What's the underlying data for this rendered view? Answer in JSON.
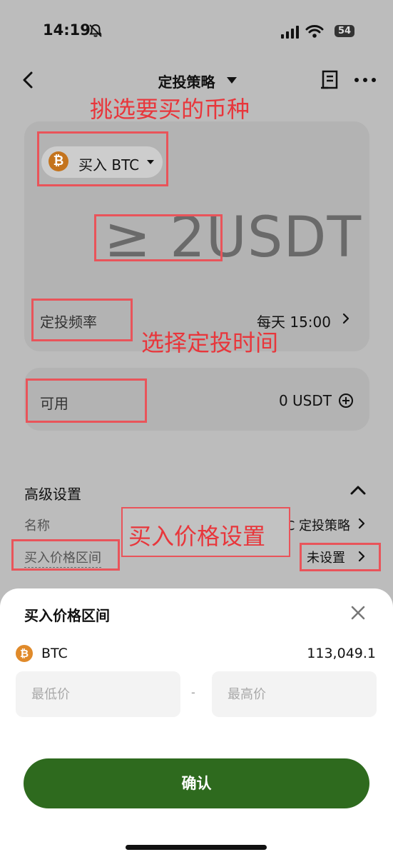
{
  "status_bar": {
    "time": "14:19",
    "battery": "54"
  },
  "nav": {
    "title": "定投策略"
  },
  "annotations": {
    "pick_coin": "挑选要买的币种",
    "pick_time": "选择定投时间",
    "buy_price": "买入价格设置"
  },
  "coin_selector": {
    "label": "买入 BTC",
    "logo": "₿"
  },
  "amount": {
    "text": "≥ 2USDT"
  },
  "frequency": {
    "label": "定投频率",
    "value": "每天 15:00"
  },
  "available": {
    "label": "可用",
    "value": "0 USDT"
  },
  "advanced": {
    "title": "高级设置",
    "name_label": "名称",
    "name_value": "BTC 定投策略",
    "price_label": "买入价格区间",
    "price_value": "未设置"
  },
  "sheet": {
    "title": "买入价格区间",
    "coin": "BTC",
    "coin_logo": "₿",
    "price": "113,049.1",
    "low_placeholder": "最低价",
    "separator": "-",
    "high_placeholder": "最高价",
    "confirm_label": "确认"
  },
  "colors": {
    "accent_green": "#2e6a1e",
    "annotation_red": "#e8363b",
    "btc_orange": "#e08a2a"
  }
}
